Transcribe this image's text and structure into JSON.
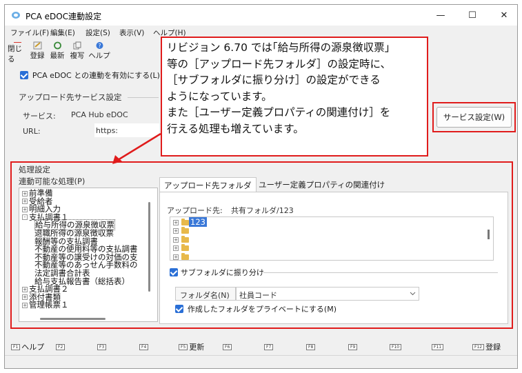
{
  "window": {
    "title": "PCA eDOC連動設定",
    "controls": {
      "minimize": "—",
      "maximize": "☐",
      "close": "✕"
    }
  },
  "menu": [
    "ファイル(F)",
    "編集(E)",
    "設定(S)",
    "表示(V)",
    "ヘルプ(H)"
  ],
  "toolbar": [
    "閉じる",
    "登録",
    "最新",
    "複写",
    "ヘルプ"
  ],
  "enable_checkbox": {
    "label": "PCA eDOC との連動を有効にする(L)",
    "checked": true
  },
  "upload_service": {
    "group_title": "アップロード先サービス設定",
    "service_label": "サービス:",
    "service_value": "PCA Hub eDOC",
    "url_label": "URL:",
    "url_value": "https:",
    "settings_button": "サービス設定(W)"
  },
  "callout": {
    "lines": [
      "リビジョン 6.70 では｢給与所得の源泉徴収票｣",
      "等の［アップロード先フォルダ］の設定時に、",
      "［サブフォルダに振り分け］の設定ができる",
      "ようになっています。",
      "また［ユーザー定義プロパティの関連付け］を",
      "行える処理も増えています。"
    ]
  },
  "processing": {
    "group_title": "処理設定",
    "list_label": "連動可能な処理(P)",
    "tree": [
      {
        "text": "前準備",
        "level": 0,
        "toggle": "+"
      },
      {
        "text": "受給者",
        "level": 0,
        "toggle": "+"
      },
      {
        "text": "明細入力",
        "level": 0,
        "toggle": "+"
      },
      {
        "text": "支払調書１",
        "level": 0,
        "toggle": "-"
      },
      {
        "text": "給与所得の源泉徴収票",
        "level": 1,
        "toggle": ""
      },
      {
        "text": "退職所得の源泉徴収票",
        "level": 1,
        "toggle": ""
      },
      {
        "text": "報酬等の支払調書",
        "level": 1,
        "toggle": ""
      },
      {
        "text": "不動産の使用料等の支払調書",
        "level": 1,
        "toggle": ""
      },
      {
        "text": "不動産等の譲受けの対価の支",
        "level": 1,
        "toggle": ""
      },
      {
        "text": "不動産等のあっせん手数料の",
        "level": 1,
        "toggle": ""
      },
      {
        "text": "法定調書合計表",
        "level": 1,
        "toggle": ""
      },
      {
        "text": "給与支払報告書（総括表）",
        "level": 1,
        "toggle": ""
      },
      {
        "text": "支払調書２",
        "level": 0,
        "toggle": "+"
      },
      {
        "text": "添付書類",
        "level": 0,
        "toggle": "+"
      },
      {
        "text": "管理帳票１",
        "level": 0,
        "toggle": "+"
      }
    ],
    "tabs": [
      "アップロード先フォルダ",
      "ユーザー定義プロパティの関連付け"
    ],
    "upload_dest_label": "アップロード先:",
    "upload_dest_value": "共有フォルダ/123",
    "folder_tree": [
      "123",
      "",
      "",
      "",
      ""
    ],
    "subfolder_checkbox": {
      "label": "サブフォルダに振り分け",
      "checked": true
    },
    "folder_name_label": "フォルダ名(N)",
    "folder_name_value": "社員コード",
    "private_checkbox": {
      "label": "作成したフォルダをプライベートにする(M)",
      "checked": true
    }
  },
  "fkeys": [
    {
      "key": "F1",
      "label": "ヘルプ"
    },
    {
      "key": "F2",
      "label": ""
    },
    {
      "key": "F3",
      "label": ""
    },
    {
      "key": "F4",
      "label": ""
    },
    {
      "key": "F5",
      "label": "更新"
    },
    {
      "key": "F6",
      "label": ""
    },
    {
      "key": "F7",
      "label": ""
    },
    {
      "key": "F8",
      "label": ""
    },
    {
      "key": "F9",
      "label": ""
    },
    {
      "key": "F10",
      "label": ""
    },
    {
      "key": "F11",
      "label": ""
    },
    {
      "key": "F12",
      "label": "登録"
    }
  ],
  "colors": {
    "accent": "#2a6fd6",
    "highlight_red": "#e01b1b",
    "selection": "#3a78d8"
  }
}
